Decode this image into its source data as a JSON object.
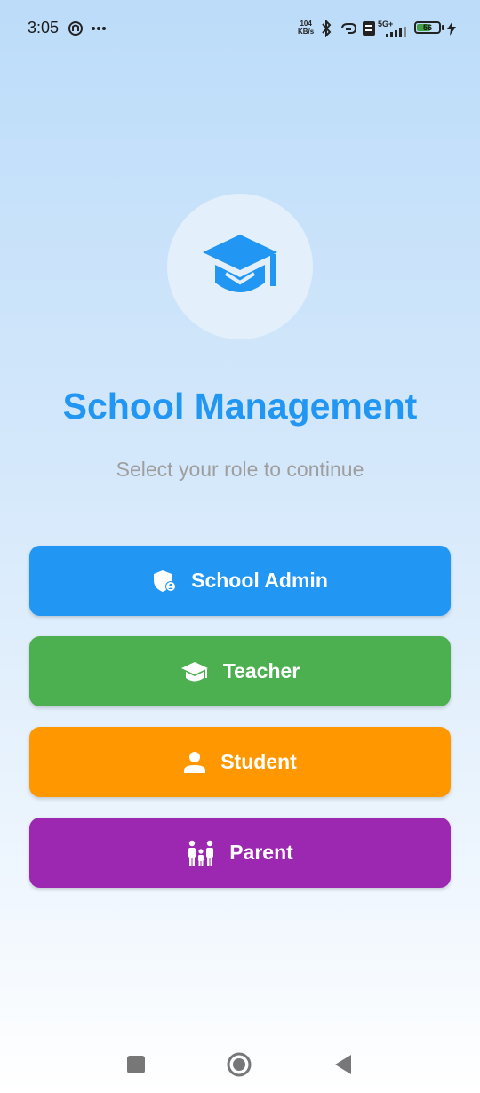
{
  "status_bar": {
    "time": "3:05",
    "net_speed_value": "104",
    "net_speed_unit": "KB/s",
    "battery_level": "56",
    "network_label": "5G+",
    "icons": [
      "sync-icon",
      "more-icon",
      "bluetooth-icon",
      "hotspot-icon",
      "volte-icon",
      "signal-icon",
      "battery-icon",
      "charging-icon"
    ]
  },
  "header": {
    "logo_icon": "graduation-cap-icon",
    "title": "School Management",
    "subtitle": "Select your role to continue"
  },
  "roles": [
    {
      "label": "School Admin",
      "icon": "admin-shield-icon",
      "color": "#2196f3"
    },
    {
      "label": "Teacher",
      "icon": "graduation-cap-icon",
      "color": "#4caf50"
    },
    {
      "label": "Student",
      "icon": "person-icon",
      "color": "#ff9800"
    },
    {
      "label": "Parent",
      "icon": "family-icon",
      "color": "#9c27b0"
    }
  ],
  "nav_bar": {
    "items": [
      "recents-square-icon",
      "home-circle-icon",
      "back-triangle-icon"
    ]
  },
  "colors": {
    "accent": "#2196f3",
    "subtitle": "#9e9e9e"
  }
}
